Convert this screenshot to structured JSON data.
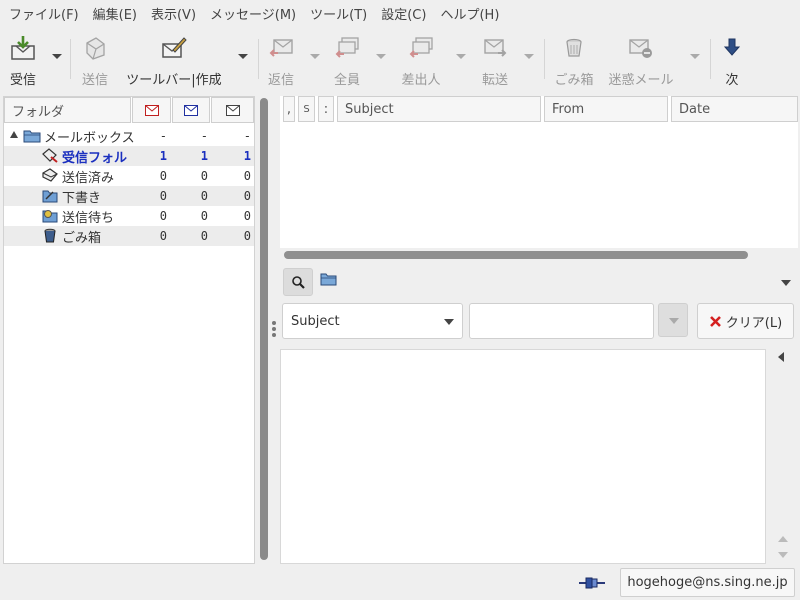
{
  "menubar": [
    "ファイル(F)",
    "編集(E)",
    "表示(V)",
    "メッセージ(M)",
    "ツール(T)",
    "設定(C)",
    "ヘルプ(H)"
  ],
  "toolbar": {
    "receive": "受信",
    "send": "送信",
    "compose": "ツールバー|作成",
    "reply": "返信",
    "reply_all": "全員",
    "sender": "差出人",
    "forward": "転送",
    "trash": "ごみ箱",
    "junk": "迷惑メール",
    "next": "次"
  },
  "folder_panel": {
    "header": "フォルダ",
    "mailbox": {
      "name": "メールボックス",
      "counts": [
        "-",
        "-",
        "-"
      ]
    },
    "folders": [
      {
        "name": "受信フォル",
        "counts": [
          "1",
          "1",
          "1"
        ],
        "icon": "inbox-icon",
        "selected": true
      },
      {
        "name": "送信済み",
        "counts": [
          "0",
          "0",
          "0"
        ],
        "icon": "sent-icon",
        "selected": false
      },
      {
        "name": "下書き",
        "counts": [
          "0",
          "0",
          "0"
        ],
        "icon": "draft-icon",
        "selected": false
      },
      {
        "name": "送信待ち",
        "counts": [
          "0",
          "0",
          "0"
        ],
        "icon": "queue-icon",
        "selected": false
      },
      {
        "name": "ごみ箱",
        "counts": [
          "0",
          "0",
          "0"
        ],
        "icon": "trash-icon",
        "selected": false
      }
    ]
  },
  "message_list": {
    "columns": [
      ",",
      "S",
      ":",
      "Subject",
      "From",
      "Date"
    ]
  },
  "search": {
    "field_selected": "Subject",
    "query": "",
    "clear_label": "クリア(L)"
  },
  "status": {
    "account": "hogehoge@ns.sing.ne.jp"
  },
  "colors": {
    "selected_folder": "#1a2fbf",
    "clear_icon": "#d42020"
  }
}
